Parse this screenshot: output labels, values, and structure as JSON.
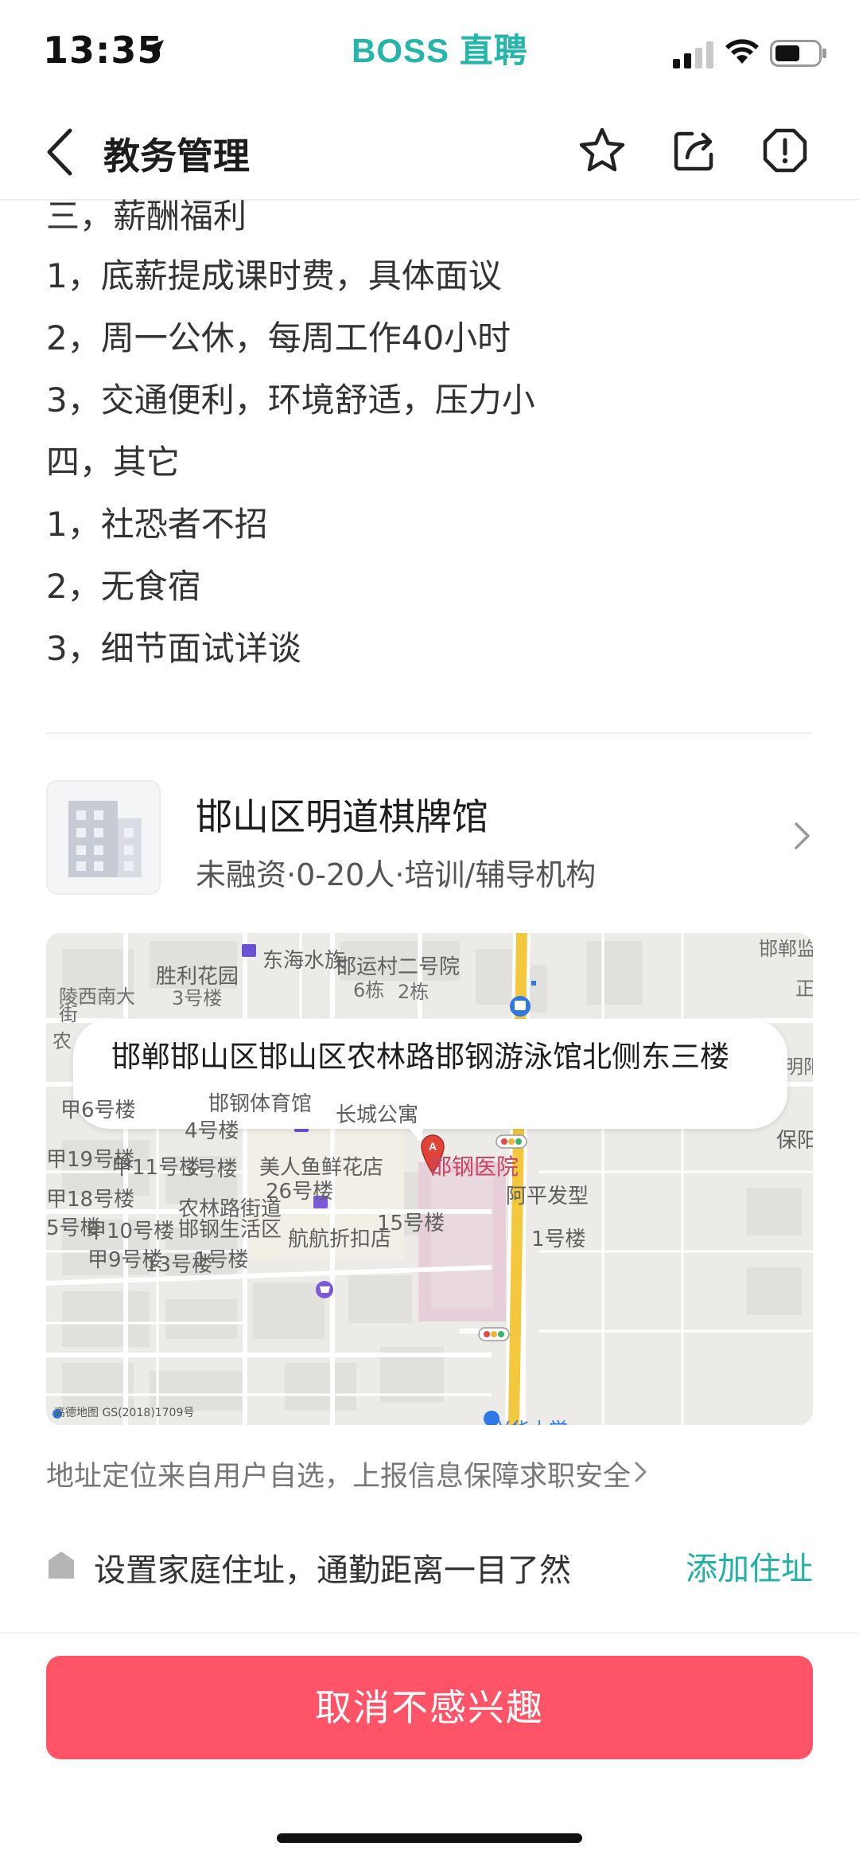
{
  "status_bar": {
    "time": "13:35",
    "brand": "BOSS 直聘"
  },
  "nav": {
    "title": "教务管理"
  },
  "description": {
    "lines": [
      "三，薪酬福利",
      "1，底薪提成课时费，具体面议",
      "2，周一公休，每周工作40小时",
      "3，交通便利，环境舒适，压力小",
      "四，其它",
      "1，社恐者不招",
      "2，无食宿",
      "3，细节面试详谈"
    ]
  },
  "company": {
    "name": "邯山区明道棋牌馆",
    "meta": "未融资·0-20人·培训/辅导机构"
  },
  "map": {
    "address": "邯郸邯山区邯山区农林路邯钢游泳馆北侧东三楼",
    "labels": {
      "donghai": "东海水族",
      "shengli": "胜利花园",
      "hanyun": "邯运村二号院",
      "lingxi": "陵西南大",
      "jie": "街",
      "nong": "农",
      "dong6": "6栋",
      "dong2": "2栋",
      "lou3a": "3号楼",
      "handing": "邯郸监",
      "zheng": "正",
      "ming": "明阳",
      "jia6": "甲6号楼",
      "hangang_gym": "邯钢体育馆",
      "changcheng": "长城公寓",
      "lou4": "4号楼",
      "baoyou": "保阳",
      "jia19": "甲19号楼",
      "jia11": "甲11号楼",
      "lou3b": "3号楼",
      "meirenyu": "美人鱼鲜花店",
      "hangang_hosp": "邯钢医院",
      "jia18": "甲18号楼",
      "lou26": "26号楼",
      "aping": "阿平发型",
      "nonglin_st": "农林路街道",
      "hangang_life": "邯钢生活区",
      "lou5": "5号楼",
      "jia10": "甲10号楼",
      "lou15": "15号楼",
      "hanghang": "航航折扣店",
      "lou1a": "1号楼",
      "jia9": "甲9号楼",
      "lou13": "13号楼",
      "lou1b": "1号楼",
      "xingfu": "兴华小学",
      "gaode": "高德地图  GS(2018)1709号"
    }
  },
  "address_note": "地址定位来自用户自选，上报信息保障求职安全",
  "home_prompt": {
    "text": "设置家庭住址，通勤距离一目了然",
    "action": "添加住址"
  },
  "cta": {
    "label": "取消不感兴趣"
  },
  "colors": {
    "brand": "#24b6a8",
    "cta": "#ff5468",
    "link": "#1fb1a3",
    "hospital": "#c94562"
  }
}
